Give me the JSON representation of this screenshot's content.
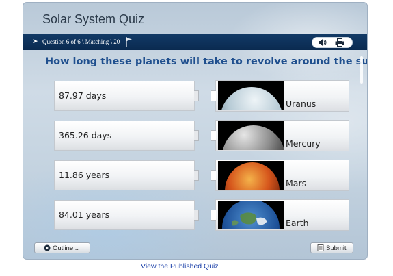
{
  "quiz": {
    "title": "Solar System Quiz",
    "progress_text": "Question 6 of 6 \\ Matching \\ 20",
    "question": "How long these planets will take to revolve around the sun?",
    "answers": [
      {
        "text": "87.97 days"
      },
      {
        "text": "365.26 days"
      },
      {
        "text": "11.86 years"
      },
      {
        "text": "84.01 years"
      }
    ],
    "targets": [
      {
        "label": "Uranus",
        "image": "uranus-image"
      },
      {
        "label": "Mercury",
        "image": "mercury-image"
      },
      {
        "label": "Mars",
        "image": "mars-image"
      },
      {
        "label": "Earth",
        "image": "earth-image"
      }
    ],
    "outline_label": "Outline...",
    "submit_label": "Submit",
    "icons": {
      "nav": "arrow-right-icon",
      "flag": "flag-icon",
      "audio": "speaker-icon",
      "print": "printer-icon",
      "outline": "play-circle-icon",
      "submit": "document-icon"
    }
  },
  "footer": {
    "link_text": "View the Published Quiz"
  },
  "colors": {
    "nav_bar": "#0f355f",
    "question": "#1f4f8e",
    "link": "#1a3fa8"
  }
}
